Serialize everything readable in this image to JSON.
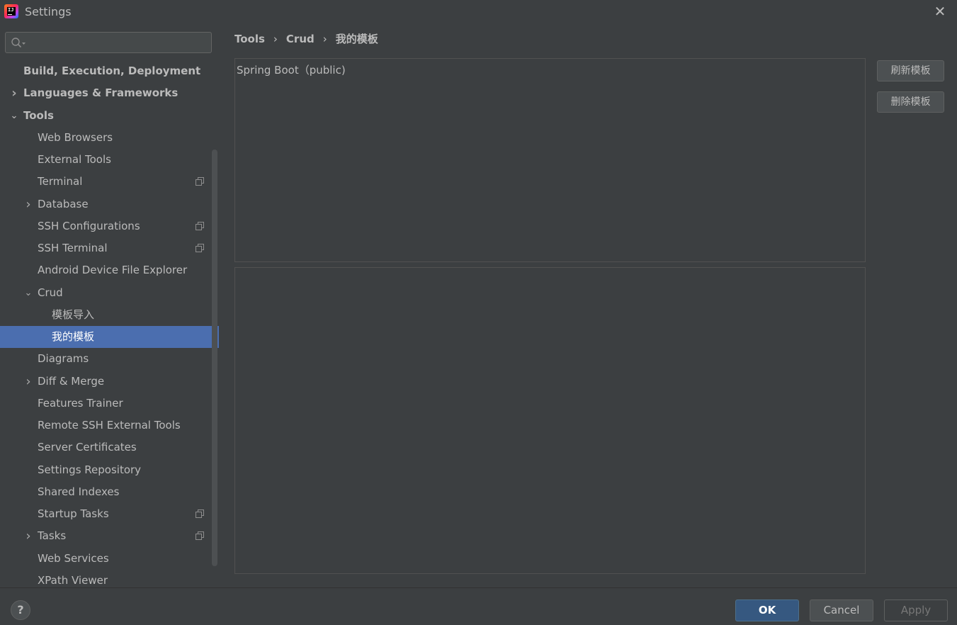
{
  "window": {
    "title": "Settings",
    "close_glyph": "✕"
  },
  "search": {
    "placeholder": "",
    "value": ""
  },
  "sidebar": {
    "items": [
      {
        "label": "Build, Execution, Deployment",
        "level": 0,
        "bold": true,
        "arrow": "",
        "copy": false,
        "selected": false
      },
      {
        "label": "Languages & Frameworks",
        "level": 0,
        "bold": true,
        "arrow": "›",
        "copy": false,
        "selected": false
      },
      {
        "label": "Tools",
        "level": 0,
        "bold": true,
        "arrow": "⌄",
        "copy": false,
        "selected": false
      },
      {
        "label": "Web Browsers",
        "level": 1,
        "bold": false,
        "arrow": "",
        "copy": false,
        "selected": false
      },
      {
        "label": "External Tools",
        "level": 1,
        "bold": false,
        "arrow": "",
        "copy": false,
        "selected": false
      },
      {
        "label": "Terminal",
        "level": 1,
        "bold": false,
        "arrow": "",
        "copy": true,
        "selected": false
      },
      {
        "label": "Database",
        "level": 1,
        "bold": false,
        "arrow": "›",
        "copy": false,
        "selected": false
      },
      {
        "label": "SSH Configurations",
        "level": 1,
        "bold": false,
        "arrow": "",
        "copy": true,
        "selected": false
      },
      {
        "label": "SSH Terminal",
        "level": 1,
        "bold": false,
        "arrow": "",
        "copy": true,
        "selected": false
      },
      {
        "label": "Android Device File Explorer",
        "level": 1,
        "bold": false,
        "arrow": "",
        "copy": false,
        "selected": false
      },
      {
        "label": "Crud",
        "level": 1,
        "bold": false,
        "arrow": "⌄",
        "copy": false,
        "selected": false
      },
      {
        "label": "模板导入",
        "level": 2,
        "bold": false,
        "arrow": "",
        "copy": false,
        "selected": false
      },
      {
        "label": "我的模板",
        "level": 2,
        "bold": false,
        "arrow": "",
        "copy": false,
        "selected": true
      },
      {
        "label": "Diagrams",
        "level": 1,
        "bold": false,
        "arrow": "",
        "copy": false,
        "selected": false
      },
      {
        "label": "Diff & Merge",
        "level": 1,
        "bold": false,
        "arrow": "›",
        "copy": false,
        "selected": false
      },
      {
        "label": "Features Trainer",
        "level": 1,
        "bold": false,
        "arrow": "",
        "copy": false,
        "selected": false
      },
      {
        "label": "Remote SSH External Tools",
        "level": 1,
        "bold": false,
        "arrow": "",
        "copy": false,
        "selected": false
      },
      {
        "label": "Server Certificates",
        "level": 1,
        "bold": false,
        "arrow": "",
        "copy": false,
        "selected": false
      },
      {
        "label": "Settings Repository",
        "level": 1,
        "bold": false,
        "arrow": "",
        "copy": false,
        "selected": false
      },
      {
        "label": "Shared Indexes",
        "level": 1,
        "bold": false,
        "arrow": "",
        "copy": false,
        "selected": false
      },
      {
        "label": "Startup Tasks",
        "level": 1,
        "bold": false,
        "arrow": "",
        "copy": true,
        "selected": false
      },
      {
        "label": "Tasks",
        "level": 1,
        "bold": false,
        "arrow": "›",
        "copy": true,
        "selected": false
      },
      {
        "label": "Web Services",
        "level": 1,
        "bold": false,
        "arrow": "",
        "copy": false,
        "selected": false
      },
      {
        "label": "XPath Viewer",
        "level": 1,
        "bold": false,
        "arrow": "",
        "copy": false,
        "selected": false
      }
    ]
  },
  "breadcrumb": {
    "part1": "Tools",
    "part2": "Crud",
    "part3": "我的模板",
    "separator": "›"
  },
  "main": {
    "template_list": [
      "Spring Boot（public)"
    ],
    "refresh_button": "刷新模板",
    "delete_button": "删除模板"
  },
  "footer": {
    "help": "?",
    "ok": "OK",
    "cancel": "Cancel",
    "apply": "Apply"
  },
  "colors": {
    "selected": "#4b6eaf",
    "background": "#3c3f41",
    "ok_button": "#365880"
  }
}
